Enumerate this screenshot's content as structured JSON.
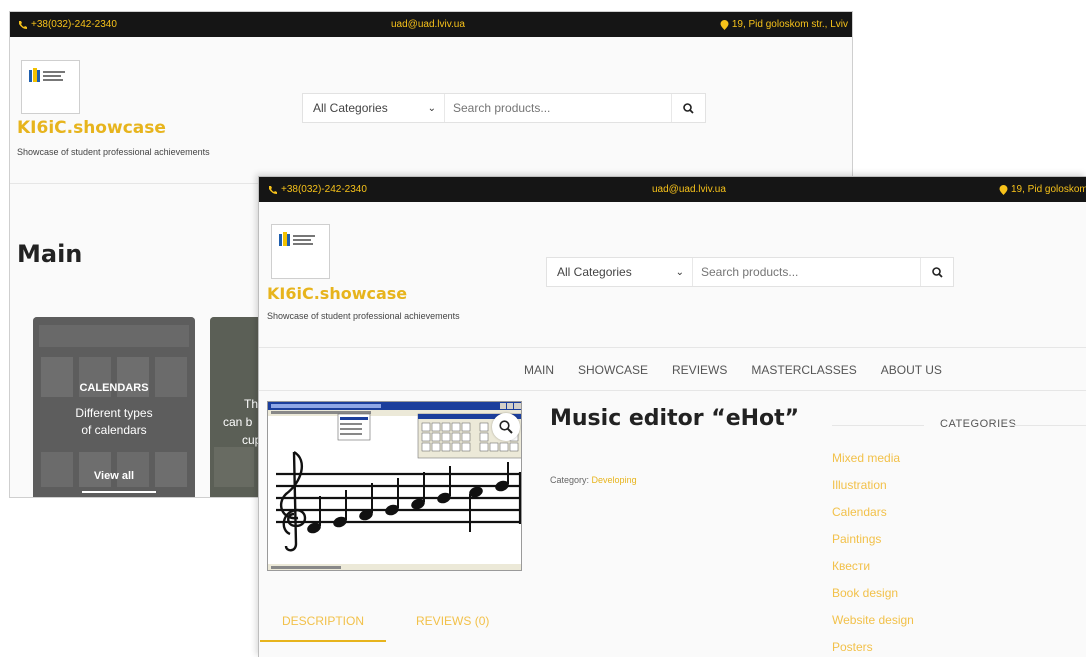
{
  "site": {
    "phone": "+38(032)-242-2340",
    "email": "uad@uad.lviv.ua",
    "address": "19, Pid goloskom str., Lviv",
    "brand": "KI6iC.showcase",
    "tagline": "Showcase of student professional achievements",
    "search_category": "All Categories",
    "search_placeholder": "Search products..."
  },
  "back_page": {
    "heading": "Main",
    "cards": [
      {
        "title": "CALENDARS",
        "subtitle": "Different types of calendars",
        "button": "View all"
      },
      {
        "text_fragments": [
          "The",
          "can b",
          "cup"
        ]
      }
    ]
  },
  "front_page": {
    "phone": "+38(032)-242-2340",
    "email": "uad@uad.lviv.ua",
    "address": "19, Pid goloskom str., Lviv",
    "nav": [
      "MAIN",
      "SHOWCASE",
      "REVIEWS",
      "MASTERCLASSES",
      "ABOUT US"
    ],
    "product": {
      "title": "Music editor “eHot”",
      "category_label": "Category:",
      "category_value": "Developing"
    },
    "categories_heading": "CATEGORIES",
    "categories": [
      "Mixed media",
      "Illustration",
      "Calendars",
      "Paintings",
      "Квести",
      "Book design",
      "Website design",
      "Posters"
    ],
    "tabs": [
      "DESCRIPTION",
      "REVIEWS (0)"
    ]
  },
  "colors": {
    "accent": "#e7b41d",
    "accent_light": "#f2c14a",
    "topbar": "#151515",
    "text_dark": "#222222"
  },
  "icons": [
    "phone-icon",
    "map-pin-icon",
    "search-icon",
    "chevron-down-icon",
    "zoom-icon",
    "logo-icon"
  ]
}
